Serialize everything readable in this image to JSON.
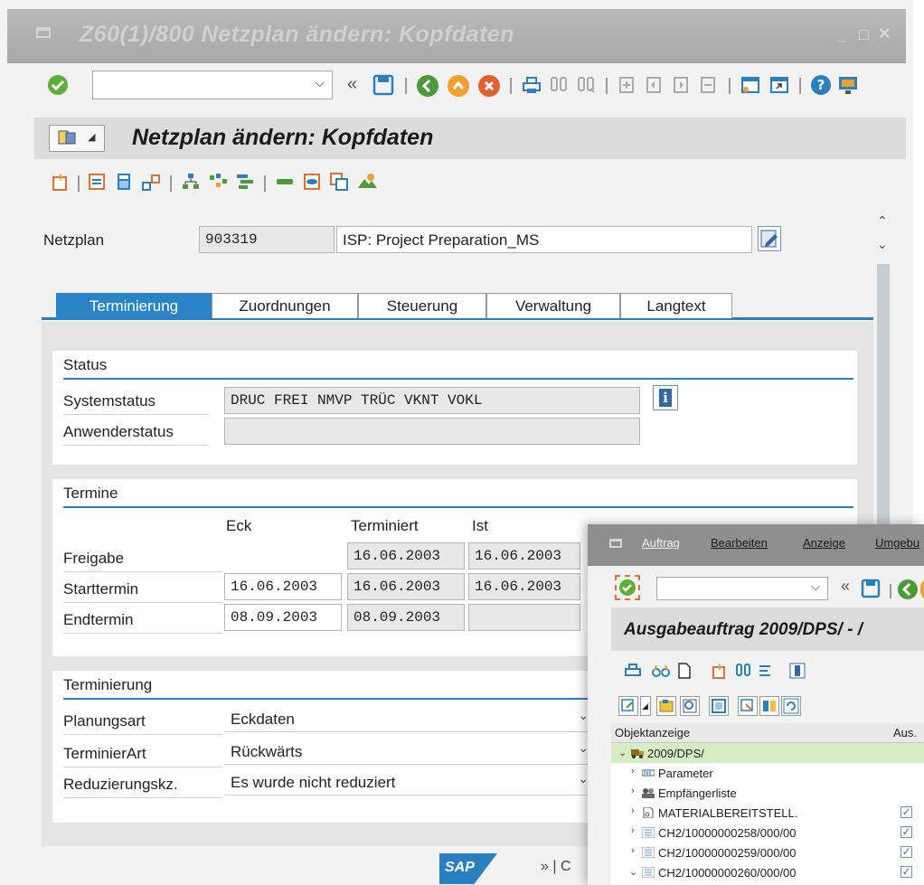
{
  "window": {
    "title": "Z60(1)/800 Netzplan ändern: Kopfdaten",
    "minimize": "_",
    "maximize": "□",
    "close": "×"
  },
  "toolbar": {
    "command_value": "",
    "back_label": "«"
  },
  "screen": {
    "title": "Netzplan ändern: Kopfdaten"
  },
  "header": {
    "netzplan_label": "Netzplan",
    "netzplan_number": "903319",
    "netzplan_description": "ISP: Project Preparation_MS"
  },
  "tabs": [
    {
      "label": "Terminierung",
      "active": true
    },
    {
      "label": "Zuordnungen",
      "active": false
    },
    {
      "label": "Steuerung",
      "active": false
    },
    {
      "label": "Verwaltung",
      "active": false
    },
    {
      "label": "Langtext",
      "active": false
    }
  ],
  "status": {
    "title": "Status",
    "systemstatus_label": "Systemstatus",
    "systemstatus_value": "DRUC FREI NMVP TRÜC VKNT VOKL",
    "anwenderstatus_label": "Anwenderstatus",
    "anwenderstatus_value": "",
    "info_label": "i"
  },
  "termine": {
    "title": "Termine",
    "col_eck": "Eck",
    "col_terminiert": "Terminiert",
    "col_ist": "Ist",
    "rows": [
      {
        "label": "Freigabe",
        "eck": "",
        "terminiert": "16.06.2003",
        "ist": "16.06.2003"
      },
      {
        "label": "Starttermin",
        "eck": "16.06.2003",
        "terminiert": "16.06.2003",
        "ist": "16.06.2003"
      },
      {
        "label": "Endtermin",
        "eck": "08.09.2003",
        "terminiert": "08.09.2003",
        "ist": ""
      }
    ]
  },
  "terminierung": {
    "title": "Terminierung",
    "planungsart_label": "Planungsart",
    "planungsart_value": "Eckdaten",
    "terminierart_label": "TerminierArt",
    "terminierart_value": "Rückwärts",
    "reduzierung_label": "Reduzierungskz.",
    "reduzierung_value": "Es wurde nicht reduziert"
  },
  "footer": {
    "logo": "SAP",
    "nav": "» | C"
  },
  "second_window": {
    "menu": [
      "Auftrag",
      "Bearbeiten",
      "Anzeige",
      "Umgebu"
    ],
    "back_label": "«",
    "title": "Ausgabeauftrag 2009/DPS/ - /",
    "tree_header": {
      "col1": "Objektanzeige",
      "col2": "Aus."
    },
    "tree": [
      {
        "label": "2009/DPS/",
        "level": 0,
        "expanded": true,
        "checked": false,
        "icon": "truck-icon"
      },
      {
        "label": "Parameter",
        "level": 1,
        "expanded": false,
        "checked": false,
        "icon": "parameter-icon"
      },
      {
        "label": "Empfängerliste",
        "level": 1,
        "expanded": false,
        "checked": false,
        "icon": "recipients-icon"
      },
      {
        "label": "MATERIALBEREITSTELL.",
        "level": 1,
        "expanded": false,
        "checked": true,
        "icon": "document-icon"
      },
      {
        "label": "CH2/10000000258/000/00",
        "level": 1,
        "expanded": false,
        "checked": true,
        "icon": "list-icon"
      },
      {
        "label": "CH2/10000000259/000/00",
        "level": 1,
        "expanded": false,
        "checked": true,
        "icon": "list-icon"
      },
      {
        "label": "CH2/10000000260/000/00",
        "level": 1,
        "expanded": true,
        "checked": true,
        "icon": "list-icon"
      }
    ],
    "check_mark": "✓"
  },
  "colors": {
    "accent": "#2a7fc0",
    "field_bg": "#e8e8e8",
    "title_bar": "#b0b0b0",
    "tree_root_bg": "#d6ecc4"
  }
}
